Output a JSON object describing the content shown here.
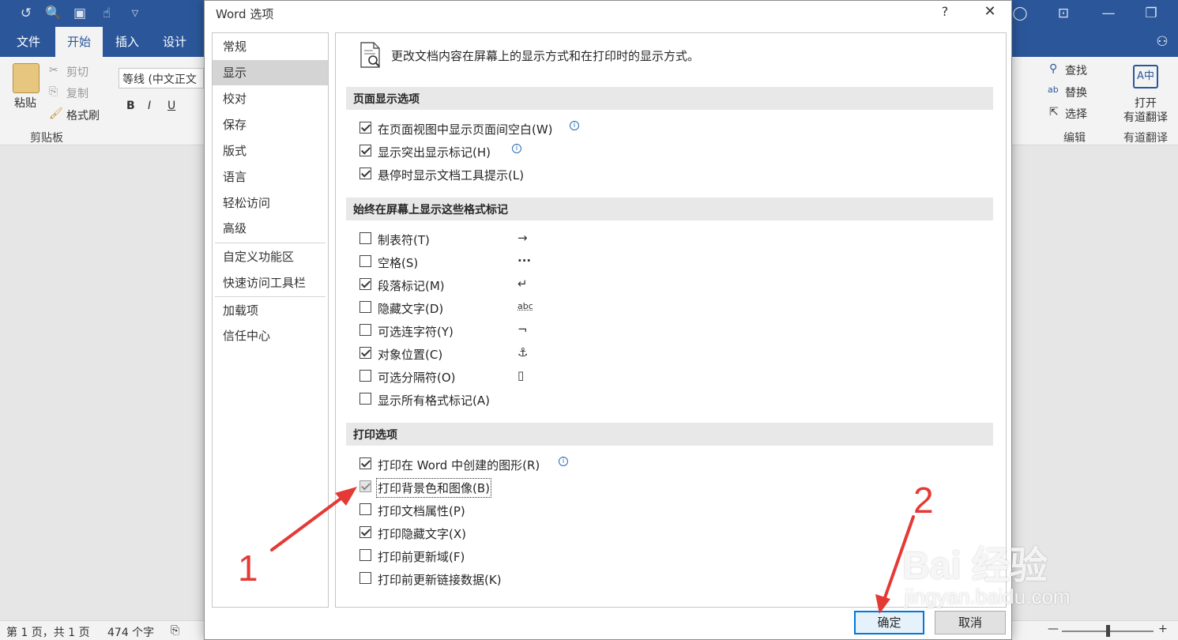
{
  "word": {
    "tabs": [
      "文件",
      "开始",
      "插入",
      "设计"
    ],
    "ribbon": {
      "paste": "粘贴",
      "cut": "剪切",
      "copy": "复制",
      "format_painter": "格式刷",
      "clipboard_group": "剪贴板",
      "font_name": "等线 (中文正文",
      "bold": "B",
      "italic": "I",
      "underline": "U",
      "find": "查找",
      "replace": "替换",
      "select": "选择",
      "edit_group": "编辑",
      "open": "打开",
      "youdao": "有道翻译",
      "youdao_group": "有道翻译"
    },
    "status": {
      "page": "第 1 页，共 1 页",
      "words": "474 个字"
    }
  },
  "dialog": {
    "title": "Word 选项",
    "help": "?",
    "close": "✕",
    "nav": [
      "常规",
      "显示",
      "校对",
      "保存",
      "版式",
      "语言",
      "轻松访问",
      "高级",
      "自定义功能区",
      "快速访问工具栏",
      "加载项",
      "信任中心"
    ],
    "selected_nav": "显示",
    "intro": "更改文档内容在屏幕上的显示方式和在打印时的显示方式。",
    "sections": {
      "page_display": {
        "title": "页面显示选项",
        "options": [
          {
            "label": "在页面视图中显示页面间空白(W)",
            "checked": true
          },
          {
            "label": "显示突出显示标记(H)",
            "checked": true
          },
          {
            "label": "悬停时显示文档工具提示(L)",
            "checked": true
          }
        ]
      },
      "format_marks": {
        "title": "始终在屏幕上显示这些格式标记",
        "options": [
          {
            "label": "制表符(T)",
            "checked": false,
            "glyph": "→"
          },
          {
            "label": "空格(S)",
            "checked": false,
            "glyph": "···"
          },
          {
            "label": "段落标记(M)",
            "checked": true,
            "glyph": "↵"
          },
          {
            "label": "隐藏文字(D)",
            "checked": false,
            "glyph": "abc"
          },
          {
            "label": "可选连字符(Y)",
            "checked": false,
            "glyph": "¬"
          },
          {
            "label": "对象位置(C)",
            "checked": true,
            "glyph": "⚓"
          },
          {
            "label": "可选分隔符(O)",
            "checked": false,
            "glyph": "▯"
          },
          {
            "label": "显示所有格式标记(A)",
            "checked": false
          }
        ]
      },
      "print": {
        "title": "打印选项",
        "options": [
          {
            "label": "打印在 Word 中创建的图形(R)",
            "checked": true
          },
          {
            "label": "打印背景色和图像(B)",
            "checked": true
          },
          {
            "label": "打印文档属性(P)",
            "checked": false
          },
          {
            "label": "打印隐藏文字(X)",
            "checked": true
          },
          {
            "label": "打印前更新域(F)",
            "checked": false
          },
          {
            "label": "打印前更新链接数据(K)",
            "checked": false
          }
        ]
      }
    },
    "buttons": {
      "ok": "确定",
      "cancel": "取消"
    }
  },
  "annotations": {
    "step1": "1",
    "step2": "2",
    "arrow_color": "#e53935"
  },
  "watermark": {
    "brand": "Bai 经验",
    "url": "jingyan.baidu.com"
  }
}
